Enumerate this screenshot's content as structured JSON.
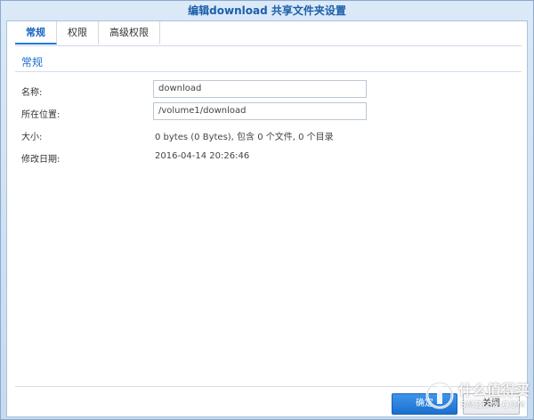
{
  "window": {
    "title": "编辑download 共享文件夹设置"
  },
  "tabs": [
    {
      "label": "常规",
      "active": true
    },
    {
      "label": "权限",
      "active": false
    },
    {
      "label": "高级权限",
      "active": false
    }
  ],
  "section": {
    "title": "常规"
  },
  "form": {
    "name_label": "名称:",
    "name_value": "download",
    "location_label": "所在位置:",
    "location_value": "/volume1/download",
    "size_label": "大小:",
    "size_value": "0 bytes (0 Bytes), 包含 0 个文件, 0 个目录",
    "modified_label": "修改日期:",
    "modified_value": "2016-04-14 20:26:46"
  },
  "footer": {
    "ok_label": "确定",
    "close_label": "关闭"
  },
  "watermark": {
    "line1": "什么值得买",
    "line2": "SMZDM.COM"
  },
  "colors": {
    "accent": "#1e7be0",
    "title_text": "#1c5fa8",
    "frame": "#c6daf0"
  }
}
